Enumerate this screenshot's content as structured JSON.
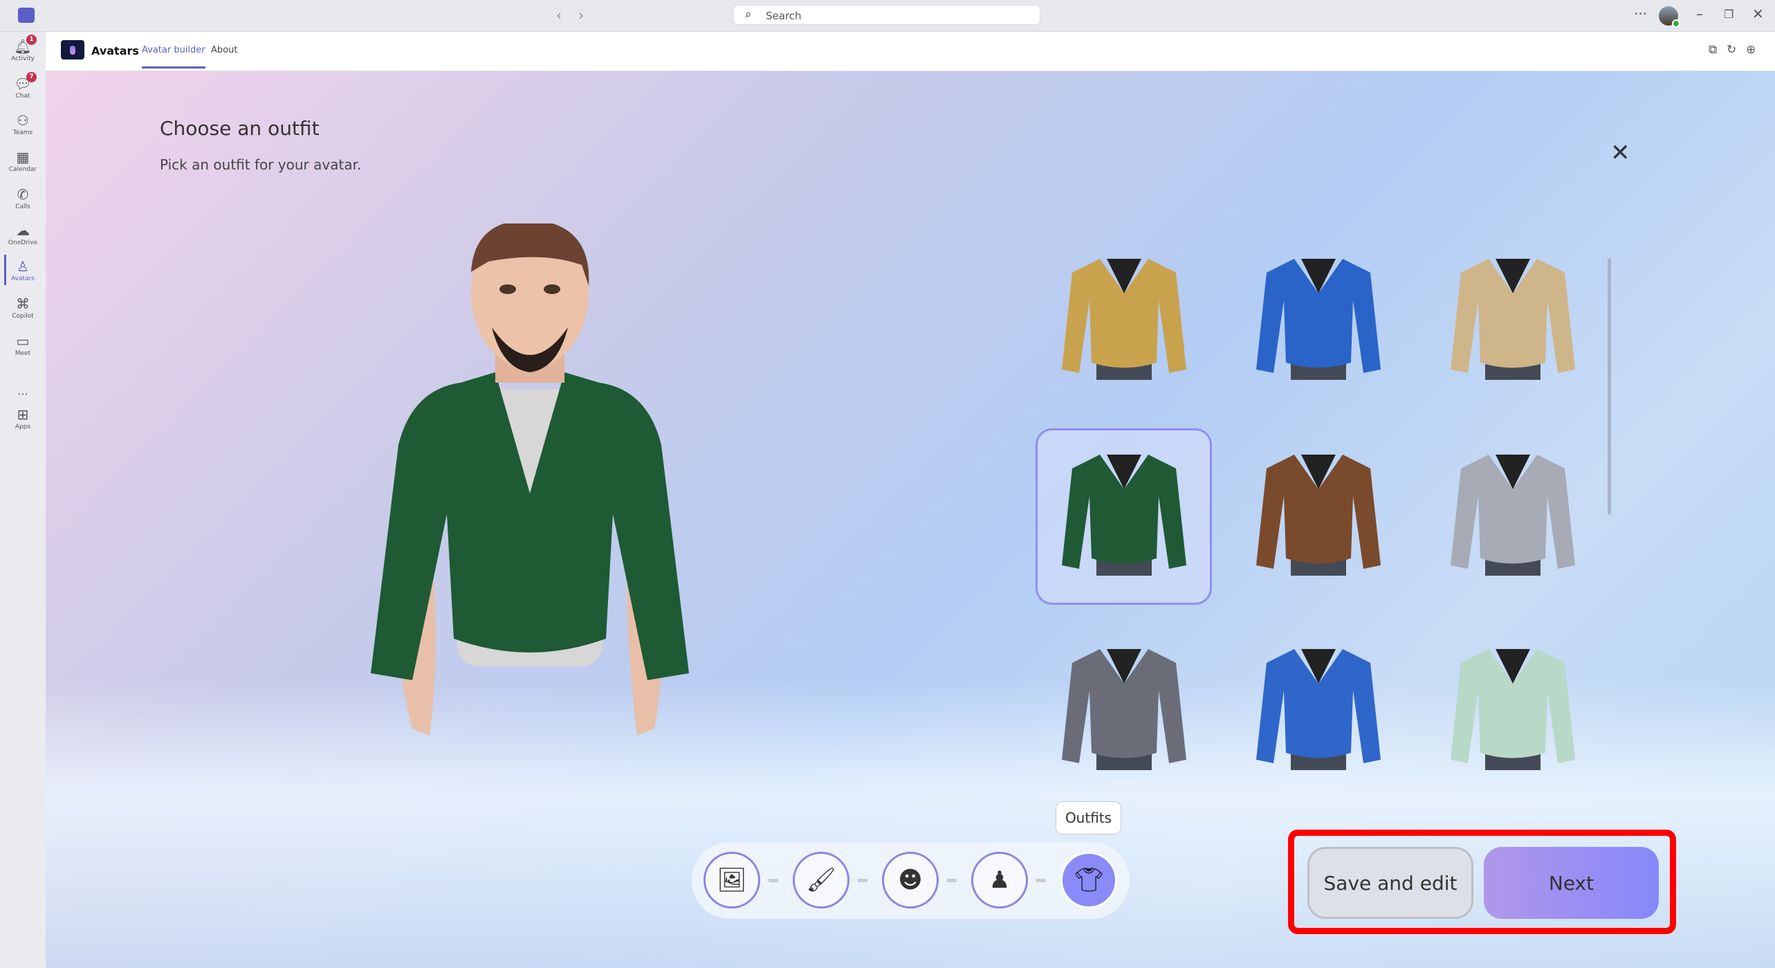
{
  "titlebar": {
    "search_placeholder": "Search",
    "more": "···"
  },
  "rail": {
    "items": [
      {
        "label": "Activity",
        "icon": "bell-icon",
        "badge": "1"
      },
      {
        "label": "Chat",
        "icon": "chat-icon",
        "badge": "7"
      },
      {
        "label": "Teams",
        "icon": "teams-icon"
      },
      {
        "label": "Calendar",
        "icon": "calendar-icon"
      },
      {
        "label": "Calls",
        "icon": "phone-icon"
      },
      {
        "label": "OneDrive",
        "icon": "cloud-icon"
      },
      {
        "label": "Avatars",
        "icon": "avatar-icon",
        "active": true
      },
      {
        "label": "Copilot",
        "icon": "copilot-icon"
      },
      {
        "label": "Meet",
        "icon": "video-icon"
      },
      {
        "label": "···",
        "icon": "more-icon"
      },
      {
        "label": "Apps",
        "icon": "add-app-icon"
      }
    ]
  },
  "app": {
    "title": "Avatars",
    "tabs": [
      {
        "label": "Avatar builder",
        "active": true
      },
      {
        "label": "About"
      }
    ]
  },
  "main": {
    "title": "Choose an outfit",
    "subtitle": "Pick an outfit for your avatar."
  },
  "outfits": [
    {
      "name": "mustard v-neck sweater",
      "color": "#c9a24e"
    },
    {
      "name": "blue suit jacket",
      "color": "#2a64c8"
    },
    {
      "name": "beige v-neck sweater",
      "color": "#cfb58a"
    },
    {
      "name": "green bomber jacket",
      "color": "#1f5a35",
      "selected": true
    },
    {
      "name": "brown leather jacket",
      "color": "#7a4a2c"
    },
    {
      "name": "grey blazer",
      "color": "#a6abb6"
    },
    {
      "name": "grey sweater",
      "color": "#6a6d78"
    },
    {
      "name": "blue blazer",
      "color": "#2f66c9"
    },
    {
      "name": "mint cardigan",
      "color": "#b8d8c8"
    }
  ],
  "steps": {
    "tooltip": "Outfits",
    "items": [
      {
        "icon": "background-icon"
      },
      {
        "icon": "paintbrush-icon"
      },
      {
        "icon": "face-icon"
      },
      {
        "icon": "body-icon"
      },
      {
        "icon": "shirt-icon",
        "active": true
      }
    ]
  },
  "actions": {
    "save": "Save and edit",
    "next": "Next"
  },
  "colors": {
    "accent": "#5b5fc7",
    "highlight": "#ff0000",
    "next_gradient": [
      "#b197ea",
      "#8688fa"
    ]
  }
}
